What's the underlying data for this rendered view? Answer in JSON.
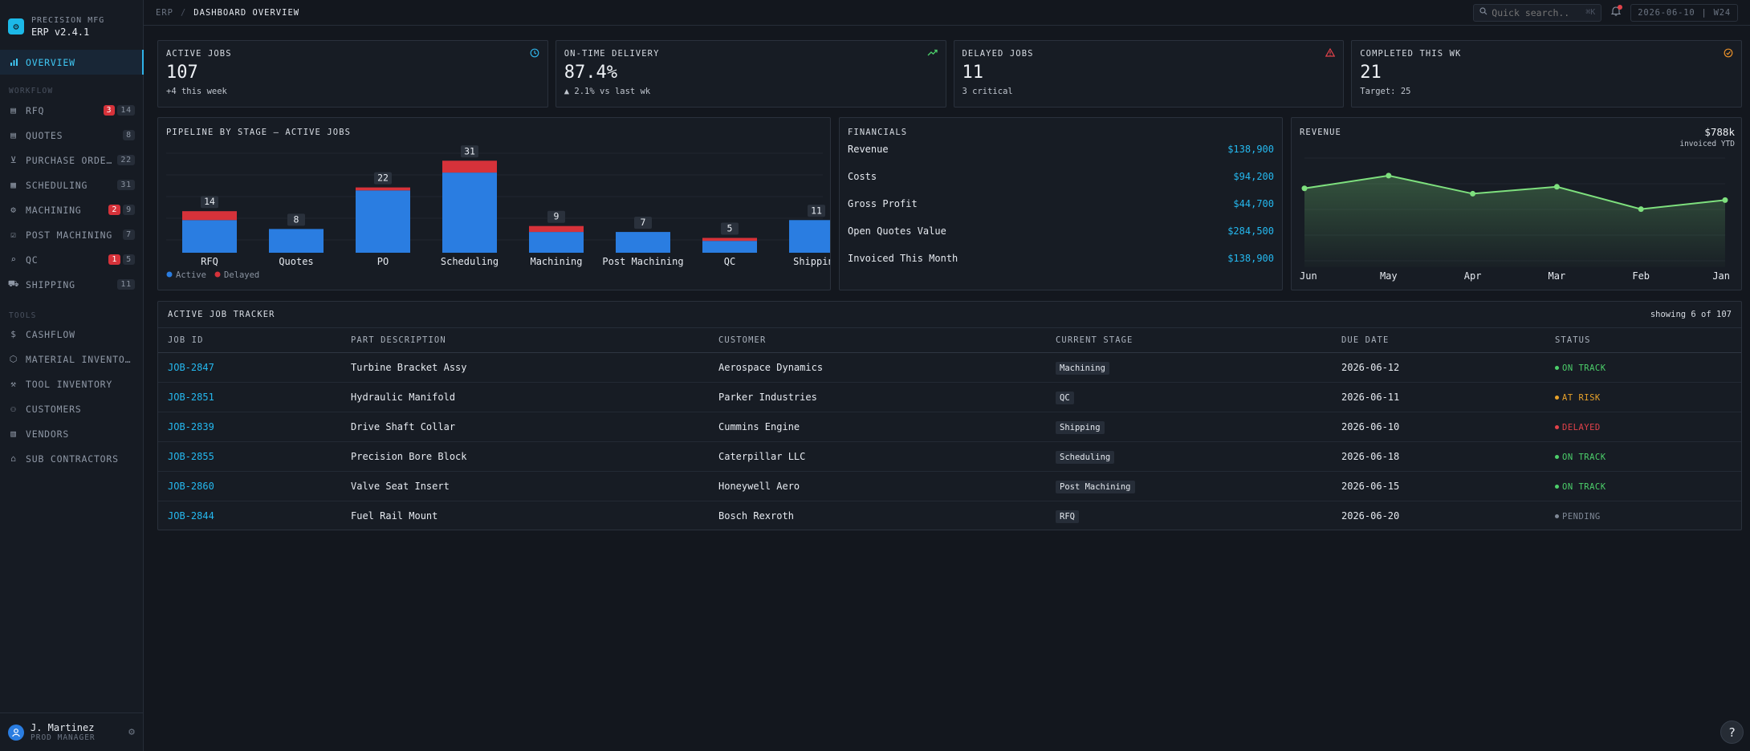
{
  "brand": {
    "company": "PRECISION MFG",
    "version": "ERP v2.4.1",
    "logo_icon": "gear-icon"
  },
  "sidebar": {
    "overview": {
      "label": "OVERVIEW",
      "icon": "bar-chart-icon"
    },
    "workflow_title": "WORKFLOW",
    "tools_title": "TOOLS",
    "workflow": [
      {
        "label": "RFQ",
        "icon": "document-icon",
        "alert": "3",
        "count": "14"
      },
      {
        "label": "QUOTES",
        "icon": "quote-icon",
        "count": "8"
      },
      {
        "label": "PURCHASE ORDERS",
        "icon": "cart-icon",
        "count": "22"
      },
      {
        "label": "SCHEDULING",
        "icon": "calendar-icon",
        "count": "31"
      },
      {
        "label": "MACHINING",
        "icon": "gear-icon",
        "alert": "2",
        "count": "9"
      },
      {
        "label": "POST MACHINING",
        "icon": "checklist-icon",
        "count": "7"
      },
      {
        "label": "QC",
        "icon": "search-icon",
        "alert": "1",
        "count": "5"
      },
      {
        "label": "SHIPPING",
        "icon": "truck-icon",
        "count": "11"
      }
    ],
    "tools": [
      {
        "label": "CASHFLOW",
        "icon": "dollar-icon"
      },
      {
        "label": "MATERIAL INVENTORY",
        "icon": "box-icon"
      },
      {
        "label": "TOOL INVENTORY",
        "icon": "wrench-icon"
      },
      {
        "label": "CUSTOMERS",
        "icon": "users-icon"
      },
      {
        "label": "VENDORS",
        "icon": "building-icon"
      },
      {
        "label": "SUB CONTRACTORS",
        "icon": "factory-icon"
      }
    ]
  },
  "user": {
    "name": "J. Martinez",
    "role": "PROD MANAGER"
  },
  "topbar": {
    "crumb_root": "ERP",
    "crumb_current": "DASHBOARD OVERVIEW",
    "search_placeholder": "Quick search...",
    "search_shortcut": "⌘K",
    "date": "2026-06-10",
    "week": "W24"
  },
  "kpis": [
    {
      "title": "ACTIVE JOBS",
      "value": "107",
      "sub": "+4 this week",
      "icon": "clock-icon",
      "color": "#2fb3e8"
    },
    {
      "title": "ON-TIME DELIVERY",
      "value": "87.4%",
      "sub": "▲ 2.1% vs last wk",
      "icon": "trend-up-icon",
      "color": "#4ccf6a"
    },
    {
      "title": "DELAYED JOBS",
      "value": "11",
      "sub": "3 critical",
      "icon": "warning-icon",
      "color": "#e2424a"
    },
    {
      "title": "COMPLETED THIS WK",
      "value": "21",
      "sub": "Target: 25",
      "icon": "check-circle-icon",
      "color": "#e8902a"
    }
  ],
  "pipeline": {
    "title": "PIPELINE BY STAGE — ACTIVE JOBS",
    "legend_active": "Active",
    "legend_delayed": "Delayed",
    "colors": {
      "active": "#2a7de1",
      "delayed": "#d6323a"
    }
  },
  "financials": {
    "title": "FINANCIALS",
    "rows": [
      {
        "label": "Revenue",
        "value": "$138,900"
      },
      {
        "label": "Costs",
        "value": "$94,200"
      },
      {
        "label": "Gross Profit",
        "value": "$44,700"
      },
      {
        "label": "Open Quotes Value",
        "value": "$284,500"
      },
      {
        "label": "Invoiced This Month",
        "value": "$138,900"
      }
    ]
  },
  "revenue": {
    "title": "REVENUE",
    "total": "$788k",
    "total_sub": "invoiced YTD",
    "color": "#7ee07e"
  },
  "chart_data": [
    {
      "type": "bar",
      "title": "PIPELINE BY STAGE — ACTIVE JOBS",
      "categories": [
        "RFQ",
        "Quotes",
        "PO",
        "Scheduling",
        "Machining",
        "Post Machining",
        "QC",
        "Shipping"
      ],
      "totals": [
        14,
        8,
        22,
        31,
        9,
        7,
        5,
        11
      ],
      "series": [
        {
          "name": "Active",
          "values": [
            11,
            8,
            21,
            27,
            7,
            7,
            4,
            11
          ]
        },
        {
          "name": "Delayed",
          "values": [
            3,
            0,
            1,
            4,
            2,
            0,
            1,
            0
          ]
        }
      ],
      "stacked": true
    },
    {
      "type": "area",
      "title": "REVENUE",
      "categories": [
        "Jun",
        "May",
        "Apr",
        "Mar",
        "Feb",
        "Jan"
      ],
      "values": [
        148,
        172,
        138,
        151,
        109,
        126
      ],
      "ylim": [
        0,
        220
      ]
    }
  ],
  "tracker": {
    "title": "ACTIVE JOB TRACKER",
    "showing": "showing 6 of 107",
    "columns": [
      "JOB ID",
      "PART DESCRIPTION",
      "CUSTOMER",
      "CURRENT STAGE",
      "DUE DATE",
      "STATUS"
    ],
    "rows": [
      {
        "id": "JOB-2847",
        "part": "Turbine Bracket Assy",
        "customer": "Aerospace Dynamics",
        "stage": "Machining",
        "due": "2026-06-12",
        "status": "ON TRACK",
        "color": "#4ccf6a"
      },
      {
        "id": "JOB-2851",
        "part": "Hydraulic Manifold",
        "customer": "Parker Industries",
        "stage": "QC",
        "due": "2026-06-11",
        "status": "AT RISK",
        "color": "#e8a22a"
      },
      {
        "id": "JOB-2839",
        "part": "Drive Shaft Collar",
        "customer": "Cummins Engine",
        "stage": "Shipping",
        "due": "2026-06-10",
        "status": "DELAYED",
        "color": "#e2424a"
      },
      {
        "id": "JOB-2855",
        "part": "Precision Bore Block",
        "customer": "Caterpillar LLC",
        "stage": "Scheduling",
        "due": "2026-06-18",
        "status": "ON TRACK",
        "color": "#4ccf6a"
      },
      {
        "id": "JOB-2860",
        "part": "Valve Seat Insert",
        "customer": "Honeywell Aero",
        "stage": "Post Machining",
        "due": "2026-06-15",
        "status": "ON TRACK",
        "color": "#4ccf6a"
      },
      {
        "id": "JOB-2844",
        "part": "Fuel Rail Mount",
        "customer": "Bosch Rexroth",
        "stage": "RFQ",
        "due": "2026-06-20",
        "status": "PENDING",
        "color": "#7f8896"
      }
    ]
  },
  "help": {
    "label": "?"
  }
}
